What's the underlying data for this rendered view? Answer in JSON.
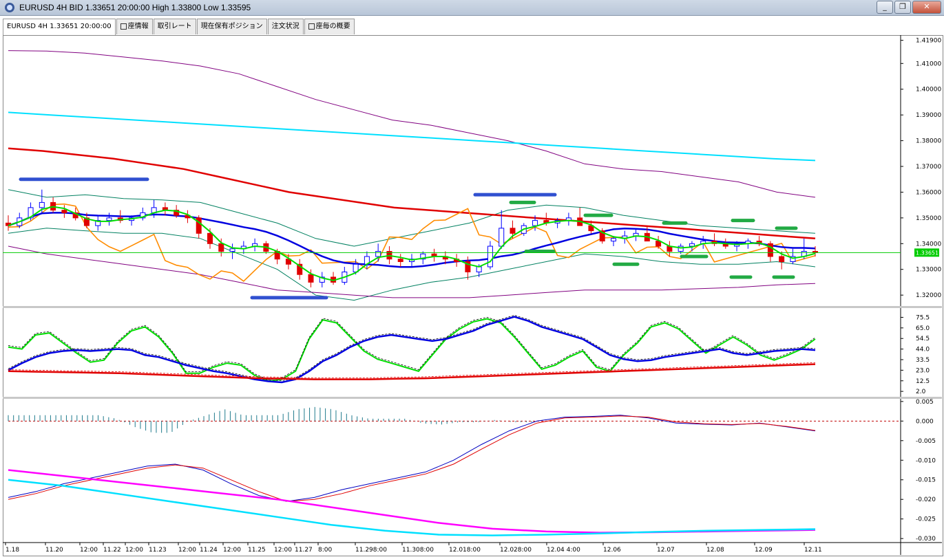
{
  "window": {
    "title": "EURUSD 4H BID 1.33651 20:00:00 High 1.33800 Low 1.33595",
    "minimize_label": "_",
    "restore_label": "❐",
    "close_label": "✕"
  },
  "tabs": [
    {
      "label": "EURUSD 4H 1.33651 20:00:00",
      "active": true,
      "check": false
    },
    {
      "label": "座情報",
      "active": false,
      "check": true
    },
    {
      "label": "取引レート",
      "active": false,
      "check": false
    },
    {
      "label": "現在保有ポジション",
      "active": false,
      "check": false
    },
    {
      "label": "注文状況",
      "active": false,
      "check": false
    },
    {
      "label": "座毎の概要",
      "active": false,
      "check": true
    }
  ],
  "price_badge": "1.33651",
  "colors": {
    "bb_outer": "#800080",
    "bb_inner": "#008060",
    "ma_long": "#e00000",
    "ma_very_long": "#00e0ff",
    "ma_mid": "#0000e0",
    "ma_fast": "#00dd00",
    "lagging": "#ff8c00",
    "level_blue": "#3050d0",
    "level_green": "#22aa44",
    "candle_up": "#0000ff",
    "candle_down": "#e00000",
    "current_price_line": "#00cc00"
  },
  "chart_data": [
    {
      "type": "candlestick",
      "name": "price",
      "y_ticks": [
        "1.41900",
        "1.41000",
        "1.40000",
        "1.39000",
        "1.38000",
        "1.37000",
        "1.36000",
        "1.35000",
        "1.34000",
        "1.33000",
        "1.32000"
      ],
      "ylim": [
        1.3163,
        1.4205
      ],
      "current_price": 1.33651,
      "candles": [
        [
          1.348,
          1.351,
          1.345,
          1.347
        ],
        [
          1.347,
          1.352,
          1.346,
          1.35
        ],
        [
          1.35,
          1.356,
          1.349,
          1.354
        ],
        [
          1.354,
          1.361,
          1.352,
          1.356
        ],
        [
          1.356,
          1.358,
          1.352,
          1.353
        ],
        [
          1.353,
          1.355,
          1.35,
          1.352
        ],
        [
          1.352,
          1.354,
          1.349,
          1.35
        ],
        [
          1.35,
          1.352,
          1.346,
          1.347
        ],
        [
          1.347,
          1.351,
          1.345,
          1.349
        ],
        [
          1.349,
          1.352,
          1.347,
          1.35
        ],
        [
          1.35,
          1.353,
          1.348,
          1.349
        ],
        [
          1.349,
          1.351,
          1.347,
          1.35
        ],
        [
          1.35,
          1.354,
          1.349,
          1.352
        ],
        [
          1.352,
          1.357,
          1.35,
          1.354
        ],
        [
          1.354,
          1.356,
          1.351,
          1.353
        ],
        [
          1.353,
          1.355,
          1.35,
          1.351
        ],
        [
          1.351,
          1.353,
          1.348,
          1.35
        ],
        [
          1.35,
          1.351,
          1.342,
          1.344
        ],
        [
          1.344,
          1.346,
          1.338,
          1.34
        ],
        [
          1.34,
          1.342,
          1.335,
          1.337
        ],
        [
          1.337,
          1.34,
          1.334,
          1.338
        ],
        [
          1.338,
          1.341,
          1.336,
          1.339
        ],
        [
          1.339,
          1.342,
          1.337,
          1.34
        ],
        [
          1.34,
          1.341,
          1.336,
          1.337
        ],
        [
          1.337,
          1.338,
          1.332,
          1.334
        ],
        [
          1.334,
          1.336,
          1.33,
          1.332
        ],
        [
          1.332,
          1.334,
          1.326,
          1.328
        ],
        [
          1.328,
          1.33,
          1.323,
          1.325
        ],
        [
          1.325,
          1.329,
          1.323,
          1.327
        ],
        [
          1.327,
          1.329,
          1.324,
          1.325
        ],
        [
          1.325,
          1.331,
          1.324,
          1.329
        ],
        [
          1.329,
          1.334,
          1.328,
          1.332
        ],
        [
          1.332,
          1.337,
          1.33,
          1.335
        ],
        [
          1.335,
          1.34,
          1.333,
          1.337
        ],
        [
          1.337,
          1.339,
          1.332,
          1.334
        ],
        [
          1.334,
          1.336,
          1.331,
          1.333
        ],
        [
          1.333,
          1.336,
          1.331,
          1.334
        ],
        [
          1.334,
          1.337,
          1.332,
          1.336
        ],
        [
          1.336,
          1.338,
          1.333,
          1.335
        ],
        [
          1.335,
          1.337,
          1.332,
          1.334
        ],
        [
          1.334,
          1.336,
          1.331,
          1.333
        ],
        [
          1.333,
          1.335,
          1.326,
          1.329
        ],
        [
          1.329,
          1.332,
          1.327,
          1.331
        ],
        [
          1.331,
          1.341,
          1.33,
          1.339
        ],
        [
          1.339,
          1.353,
          1.338,
          1.346
        ],
        [
          1.346,
          1.349,
          1.342,
          1.344
        ],
        [
          1.344,
          1.348,
          1.343,
          1.347
        ],
        [
          1.347,
          1.351,
          1.345,
          1.349
        ],
        [
          1.349,
          1.352,
          1.347,
          1.348
        ],
        [
          1.348,
          1.35,
          1.346,
          1.349
        ],
        [
          1.349,
          1.352,
          1.347,
          1.35
        ],
        [
          1.35,
          1.354,
          1.348,
          1.347
        ],
        [
          1.347,
          1.349,
          1.344,
          1.345
        ],
        [
          1.345,
          1.346,
          1.34,
          1.341
        ],
        [
          1.341,
          1.343,
          1.339,
          1.342
        ],
        [
          1.342,
          1.345,
          1.34,
          1.343
        ],
        [
          1.343,
          1.346,
          1.341,
          1.344
        ],
        [
          1.344,
          1.347,
          1.342,
          1.341
        ],
        [
          1.341,
          1.343,
          1.338,
          1.339
        ],
        [
          1.339,
          1.341,
          1.335,
          1.337
        ],
        [
          1.337,
          1.34,
          1.336,
          1.339
        ],
        [
          1.339,
          1.341,
          1.337,
          1.34
        ],
        [
          1.34,
          1.343,
          1.338,
          1.341
        ],
        [
          1.341,
          1.344,
          1.339,
          1.34
        ],
        [
          1.34,
          1.342,
          1.338,
          1.339
        ],
        [
          1.339,
          1.341,
          1.337,
          1.34
        ],
        [
          1.34,
          1.342,
          1.338,
          1.341
        ],
        [
          1.341,
          1.343,
          1.339,
          1.34
        ],
        [
          1.34,
          1.341,
          1.333,
          1.335
        ],
        [
          1.335,
          1.337,
          1.33,
          1.333
        ],
        [
          1.333,
          1.338,
          1.332,
          1.335
        ],
        [
          1.335,
          1.342,
          1.334,
          1.337
        ],
        [
          1.337,
          1.339,
          1.335,
          1.3365
        ]
      ],
      "series": [
        {
          "role": "bb_outer_top",
          "values": [
            1.415,
            1.4148,
            1.414,
            1.4125,
            1.411,
            1.409,
            1.406,
            1.401,
            1.396,
            1.392,
            1.388,
            1.386,
            1.383,
            1.38,
            1.376,
            1.371,
            1.369,
            1.368,
            1.366,
            1.364,
            1.36,
            1.358
          ]
        },
        {
          "role": "bb_inner_top",
          "values": [
            1.361,
            1.358,
            1.359,
            1.3575,
            1.357,
            1.356,
            1.352,
            1.348,
            1.342,
            1.339,
            1.342,
            1.345,
            1.348,
            1.353,
            1.355,
            1.354,
            1.351,
            1.349,
            1.347,
            1.346,
            1.345,
            1.344
          ]
        },
        {
          "role": "bb_inner_bot",
          "values": [
            1.344,
            1.346,
            1.345,
            1.344,
            1.344,
            1.342,
            1.336,
            1.33,
            1.32,
            1.318,
            1.322,
            1.325,
            1.327,
            1.33,
            1.333,
            1.336,
            1.335,
            1.333,
            1.332,
            1.332,
            1.333,
            1.331
          ]
        },
        {
          "role": "bb_outer_bot",
          "values": [
            1.339,
            1.336,
            1.334,
            1.332,
            1.33,
            1.328,
            1.325,
            1.322,
            1.321,
            1.32,
            1.319,
            1.319,
            1.319,
            1.32,
            1.321,
            1.322,
            1.322,
            1.322,
            1.3225,
            1.323,
            1.324,
            1.3245
          ]
        },
        {
          "role": "ma_very_long",
          "values": [
            1.391,
            1.39,
            1.389,
            1.388,
            1.387,
            1.386,
            1.385,
            1.384,
            1.383,
            1.382,
            1.381,
            1.38,
            1.379,
            1.378,
            1.377,
            1.376,
            1.375,
            1.374,
            1.373,
            1.3723
          ]
        },
        {
          "role": "ma_long",
          "values": [
            1.377,
            1.376,
            1.3745,
            1.373,
            1.371,
            1.369,
            1.366,
            1.363,
            1.36,
            1.358,
            1.356,
            1.354,
            1.353,
            1.352,
            1.351,
            1.35,
            1.349,
            1.348,
            1.347,
            1.346,
            1.345,
            1.344,
            1.343,
            1.342
          ]
        }
      ],
      "level_markers": [
        {
          "color": "blue",
          "y": 1.365
        },
        {
          "color": "blue",
          "y": 1.319
        },
        {
          "color": "blue",
          "y": 1.359
        },
        {
          "color": "green",
          "y": 1.356
        },
        {
          "color": "green",
          "y": 1.337
        },
        {
          "color": "green",
          "y": 1.351
        },
        {
          "color": "green",
          "y": 1.332
        },
        {
          "color": "green",
          "y": 1.348
        },
        {
          "color": "green",
          "y": 1.335
        },
        {
          "color": "green",
          "y": 1.349
        },
        {
          "color": "green",
          "y": 1.327
        },
        {
          "color": "green",
          "y": 1.346
        },
        {
          "color": "green",
          "y": 1.327
        }
      ]
    },
    {
      "type": "line",
      "name": "oscillator",
      "y_ticks": [
        "75.5",
        "65.0",
        "54.5",
        "44.0",
        "33.5",
        "23.0",
        "12.5",
        "2.0"
      ],
      "ylim": [
        -2,
        84
      ],
      "series": [
        {
          "role": "green_fast",
          "values": [
            46,
            44,
            58,
            60,
            50,
            40,
            31,
            33,
            50,
            62,
            66,
            56,
            40,
            20,
            20,
            26,
            30,
            28,
            18,
            12,
            14,
            22,
            54,
            73,
            70,
            56,
            42,
            34,
            30,
            26,
            22,
            38,
            54,
            64,
            71,
            74,
            70,
            56,
            40,
            24,
            28,
            36,
            42,
            26,
            22,
            38,
            50,
            66,
            70,
            64,
            52,
            40,
            48,
            56,
            48,
            38,
            33,
            38,
            44,
            54
          ]
        },
        {
          "role": "blue_mid",
          "values": [
            23,
            30,
            36,
            40,
            42,
            43,
            42,
            43,
            44,
            43,
            38,
            36,
            32,
            28,
            25,
            22,
            20,
            17,
            14,
            12,
            11,
            14,
            22,
            32,
            38,
            46,
            52,
            56,
            58,
            56,
            54,
            52,
            54,
            58,
            62,
            68,
            72,
            76,
            72,
            66,
            62,
            58,
            54,
            46,
            38,
            34,
            32,
            33,
            36,
            38,
            40,
            42,
            44,
            40,
            38,
            40,
            42,
            43,
            44,
            43
          ]
        },
        {
          "role": "red_slow",
          "values": [
            22,
            21.5,
            21,
            20.5,
            20,
            19,
            18,
            17,
            16,
            15,
            14.5,
            14,
            14,
            14,
            14.5,
            15,
            16,
            17,
            18,
            19,
            20,
            21,
            22,
            23,
            24,
            25,
            26,
            27,
            28,
            29
          ]
        }
      ]
    },
    {
      "type": "line",
      "name": "macd",
      "y_ticks": [
        "0.005",
        "0.000",
        "-0.005",
        "-0.010",
        "-0.015",
        "-0.020",
        "-0.025",
        "-0.030"
      ],
      "ylim": [
        -0.0305,
        0.0055
      ],
      "series": [
        {
          "role": "main",
          "values": [
            -0.0195,
            -0.018,
            -0.016,
            -0.0145,
            -0.013,
            -0.0115,
            -0.011,
            -0.0125,
            -0.016,
            -0.019,
            -0.0205,
            -0.0195,
            -0.0175,
            -0.016,
            -0.0145,
            -0.013,
            -0.01,
            -0.006,
            -0.0025,
            0.0,
            0.001,
            0.0012,
            0.0015,
            0.0008,
            -0.0005,
            -0.0008,
            -0.001,
            -0.0005,
            -0.0015,
            -0.0025
          ]
        },
        {
          "role": "signal",
          "values": [
            -0.02,
            -0.0185,
            -0.0165,
            -0.015,
            -0.0135,
            -0.012,
            -0.0112,
            -0.012,
            -0.015,
            -0.018,
            -0.0205,
            -0.02,
            -0.0185,
            -0.0165,
            -0.015,
            -0.0135,
            -0.011,
            -0.0072,
            -0.0035,
            -0.0005,
            0.0008,
            0.001,
            0.0013,
            0.001,
            -0.0002,
            -0.0007,
            -0.0009,
            -0.0006,
            -0.0014,
            -0.0024
          ]
        },
        {
          "role": "magenta",
          "values": [
            -0.0125,
            -0.014,
            -0.0155,
            -0.017,
            -0.0185,
            -0.02,
            -0.022,
            -0.024,
            -0.026,
            -0.0275,
            -0.0282,
            -0.0285,
            -0.0284,
            -0.0282,
            -0.028,
            -0.0278
          ]
        },
        {
          "role": "cyan",
          "values": [
            -0.015,
            -0.0165,
            -0.0185,
            -0.0205,
            -0.0225,
            -0.0245,
            -0.0265,
            -0.028,
            -0.029,
            -0.0292,
            -0.029,
            -0.0287,
            -0.0283,
            -0.028,
            -0.0278,
            -0.0276
          ]
        }
      ]
    }
  ],
  "x_labels": [
    "1.18",
    "11.20",
    "12:00",
    "11.22",
    "12:00",
    "11.23",
    "12:00",
    "11.24",
    "12:00",
    "11.25",
    "12:00",
    "11.27",
    "8:00",
    "11.298:00",
    "11.308:00",
    "12.018:00",
    "12.028:00",
    "12.04 4:00",
    "12.06",
    "12.07",
    "12.08",
    "12.09",
    "12.11"
  ]
}
